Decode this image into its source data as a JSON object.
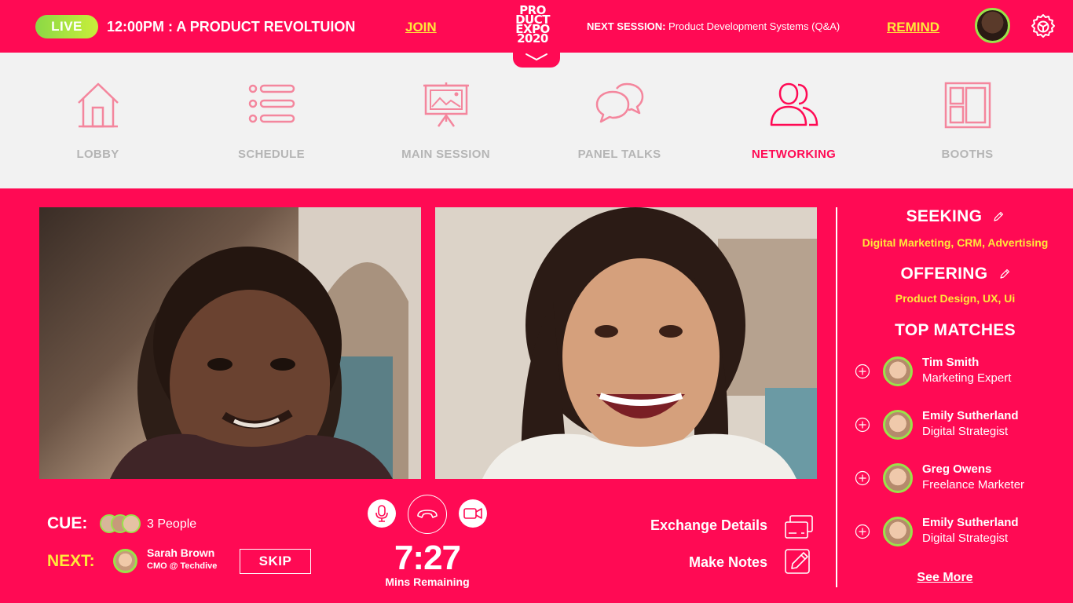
{
  "topbar": {
    "live_badge": "LIVE",
    "live_title": "12:00PM : A PRODUCT REVOLTUION",
    "join_label": "JOIN",
    "logo_lines": [
      "PRO",
      "DUCT",
      "EXPO",
      "2020"
    ],
    "next_session_prefix": "NEXT SESSION:",
    "next_session_title": "Product Development Systems (Q&A)",
    "remind_label": "REMIND"
  },
  "nav": {
    "items": [
      {
        "label": "LOBBY",
        "icon": "house-icon"
      },
      {
        "label": "SCHEDULE",
        "icon": "list-icon"
      },
      {
        "label": "MAIN SESSION",
        "icon": "presentation-icon"
      },
      {
        "label": "PANEL TALKS",
        "icon": "chat-bubbles-icon"
      },
      {
        "label": "NETWORKING",
        "icon": "people-icon",
        "active": true
      },
      {
        "label": "BOOTHS",
        "icon": "booth-layout-icon"
      }
    ]
  },
  "call": {
    "cue_label": "CUE:",
    "cue_count": "3 People",
    "next_label": "NEXT:",
    "next_name": "Sarah Brown",
    "next_role": "CMO @ Techdive",
    "skip_label": "SKIP",
    "timer": "7:27",
    "timer_sub": "Mins Remaining",
    "exchange_label": "Exchange Details",
    "notes_label": "Make Notes"
  },
  "panel": {
    "seeking_title": "SEEKING",
    "seeking_value": "Digital Marketing, CRM, Advertising",
    "offering_title": "OFFERING",
    "offering_value": "Product Design, UX, Ui",
    "top_matches_title": "TOP MATCHES",
    "matches": [
      {
        "name": "Tim Smith",
        "role": "Marketing Expert"
      },
      {
        "name": "Emily Sutherland",
        "role": "Digital Strategist"
      },
      {
        "name": "Greg Owens",
        "role": "Freelance Marketer"
      },
      {
        "name": "Emily Sutherland",
        "role": "Digital Strategist"
      }
    ],
    "see_more": "See More"
  },
  "colors": {
    "brand": "#ff0a54",
    "accent": "#ffe83a",
    "live": "#8bd846",
    "nav_bg": "#f2f2f2",
    "nav_inactive": "#b5b5b5"
  }
}
